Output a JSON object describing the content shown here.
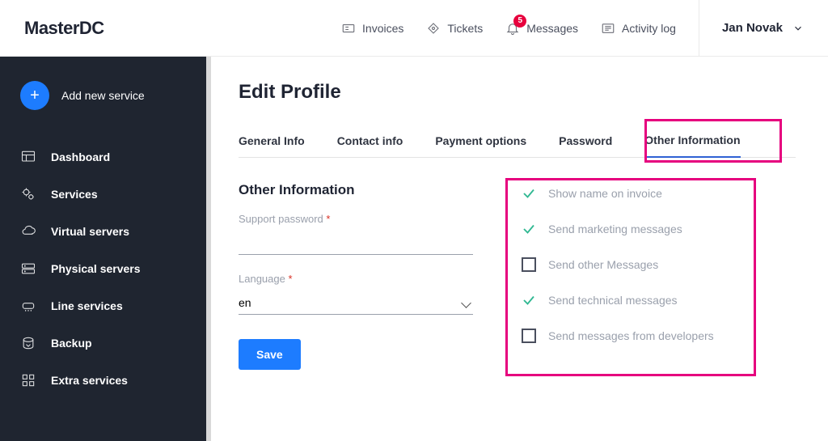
{
  "header": {
    "logo": "MasterDC",
    "nav": {
      "invoices": "Invoices",
      "tickets": "Tickets",
      "messages": "Messages",
      "messages_badge": "5",
      "activity": "Activity log"
    },
    "user": "Jan Novak"
  },
  "sidebar": {
    "add_label": "Add new service",
    "items": [
      {
        "label": "Dashboard"
      },
      {
        "label": "Services"
      },
      {
        "label": "Virtual servers"
      },
      {
        "label": "Physical servers"
      },
      {
        "label": "Line services"
      },
      {
        "label": "Backup"
      },
      {
        "label": "Extra services"
      }
    ]
  },
  "page": {
    "title": "Edit Profile",
    "tabs": {
      "general": "General Info",
      "contact": "Contact info",
      "payment": "Payment options",
      "password": "Password",
      "other": "Other Information"
    },
    "section_title": "Other Information",
    "support_password_label": "Support password",
    "language_label": "Language",
    "language_value": "en",
    "save_label": "Save",
    "options": {
      "show_name": "Show name on invoice",
      "marketing": "Send marketing messages",
      "other_msgs": "Send other Messages",
      "technical": "Send technical messages",
      "developers": "Send messages from developers"
    }
  }
}
